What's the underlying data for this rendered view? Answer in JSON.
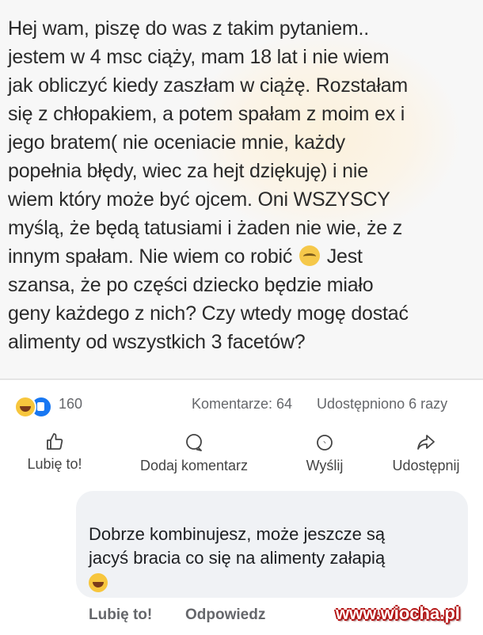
{
  "post": {
    "lines": [
      "Hej wam, piszę do was z takim pytaniem..",
      "jestem w 4 msc ciąży, mam 18 lat i nie wiem",
      "jak obliczyć kiedy zaszłam w ciążę. Rozstałam",
      "się z chłopakiem, a potem spałam z moim ex i",
      "jego bratem( nie oceniacie mnie, każdy",
      "popełnia błędy, wiec za hejt dziękuję)  i nie",
      "wiem który może być ojcem. Oni WSZYSCY",
      "myślą, że będą tatusiami i żaden nie wie, że  z",
      "innym spałam. Nie wiem co robić",
      "szansa, że po części dziecko będzie miało",
      "geny każdego z nich? Czy wtedy mogę dostać",
      "alimenty od wszystkich 3 facetów?"
    ],
    "line9_after_emoji": "Jest"
  },
  "stats": {
    "reaction_count": "160",
    "comments": "Komentarze: 64",
    "shares": "Udostępniono 6 razy"
  },
  "actions": {
    "like": "Lubię to!",
    "comment": "Dodaj komentarz",
    "send": "Wyślij",
    "share": "Udostępnij"
  },
  "comment": {
    "lines": [
      "Dobrze kombinujesz,  może jeszcze są",
      "jacyś bracia co się na alimenty załapią"
    ],
    "like_label": "Lubię to!",
    "reply_label": "Odpowiedz"
  },
  "watermark": "www.wiocha.pl",
  "colors": {
    "like_blue": "#1877f2",
    "haha_yellow": "#f7c63d",
    "watermark_red": "#b31313"
  }
}
